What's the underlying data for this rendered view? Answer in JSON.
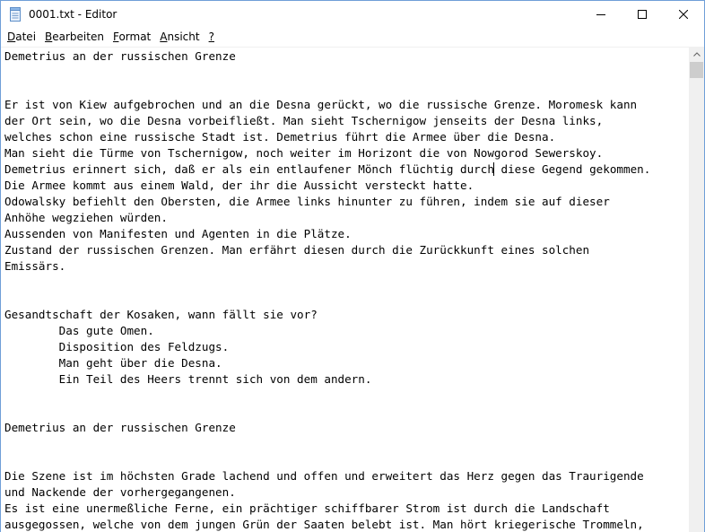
{
  "window": {
    "title": "0001.txt - Editor",
    "icon": "notepad-icon",
    "controls": [
      "minimize-icon",
      "maximize-icon",
      "close-icon"
    ]
  },
  "menu": [
    {
      "label": "Datei",
      "mnemonic_index": 0
    },
    {
      "label": "Bearbeiten",
      "mnemonic_index": 0
    },
    {
      "label": "Format",
      "mnemonic_index": 0
    },
    {
      "label": "Ansicht",
      "mnemonic_index": 0
    },
    {
      "label": "?",
      "mnemonic_index": 0
    }
  ],
  "document": {
    "lines": [
      "Demetrius an der russischen Grenze",
      "",
      "",
      "Er ist von Kiew aufgebrochen und an die Desna gerückt, wo die russische Grenze. Moromesk kann",
      "der Ort sein, wo die Desna vorbeifließt. Man sieht Tschernigow jenseits der Desna links,",
      "welches schon eine russische Stadt ist. Demetrius führt die Armee über die Desna.",
      "Man sieht die Türme von Tschernigow, noch weiter im Horizont die von Nowgorod Sewerskoy.",
      "Demetrius erinnert sich, daß er als ein entlaufener Mönch flüchtig durch diese Gegend gekommen.",
      "Die Armee kommt aus einem Wald, der ihr die Aussicht versteckt hatte.",
      "Odowalsky befiehlt den Obersten, die Armee links hinunter zu führen, indem sie auf dieser",
      "Anhöhe wegziehen würden.",
      "Aussenden von Manifesten und Agenten in die Plätze.",
      "Zustand der russischen Grenzen. Man erfährt diesen durch die Zurückkunft eines solchen",
      "Emissärs.",
      "",
      "",
      "Gesandtschaft der Kosaken, wann fällt sie vor?",
      "        Das gute Omen.",
      "        Disposition des Feldzugs.",
      "        Man geht über die Desna.",
      "        Ein Teil des Heers trennt sich von dem andern.",
      "",
      "",
      "Demetrius an der russischen Grenze",
      "",
      "",
      "Die Szene ist im höchsten Grade lachend und offen und erweitert das Herz gegen das Traurigende",
      "und Nackende der vorhergegangenen.",
      "Es ist eine unermeßliche Ferne, ein prächtiger schiffbarer Strom ist durch die Landschaft",
      "ausgegossen, welche von dem jungen Grün der Saaten belebt ist. Man hört kriegerische Trommeln,"
    ],
    "caret": {
      "line": 7,
      "after_text": "Demetrius erinnert sich, daß er als ein entlaufener Mönch flüchtig durch"
    }
  }
}
